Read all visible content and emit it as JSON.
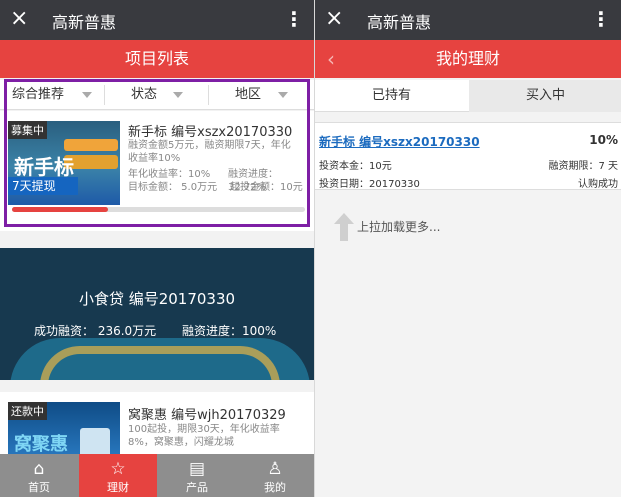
{
  "colors": {
    "accent": "#e64340",
    "titlebar": "#393a3f",
    "highlight": "#7e1fa5",
    "link": "#1c6bbf"
  },
  "left": {
    "titlebar": {
      "close_icon": "×",
      "title": "高新普惠",
      "more_icon": "⋮"
    },
    "header": "项目列表",
    "filters": [
      "综合推荐",
      "状态",
      "地区"
    ],
    "card1": {
      "status": "募集中",
      "thumb_big": "新手标",
      "thumb_strip": "7天提现",
      "title": "新手标 编号xszx20170330",
      "desc": "融资金额5万元，融资期限7天，年化",
      "desc2": "收益率10%",
      "rate_label": "年化收益率：10%",
      "progress_label": "融资进度：32.72%",
      "target_label": "目标金额：   5.0万元",
      "min_label": "起投金额：10元",
      "progress": 0.3272
    },
    "banner": {
      "title": "小食贷 编号20170330",
      "success": "成功融资：  236.0万元",
      "progress": "融资进度：100%"
    },
    "card2": {
      "status": "还款中",
      "thumb_big": "窝聚惠",
      "title": "窝聚惠 编号wjh20170329",
      "desc": "100起投，期限30天，年化收益率",
      "desc2": "8%，窝聚惠，闪耀龙城"
    },
    "tabs": [
      {
        "icon": "⌂",
        "label": "首页"
      },
      {
        "icon": "☆",
        "label": "理财"
      },
      {
        "icon": "▤",
        "label": "产品"
      },
      {
        "icon": "♙",
        "label": "我的"
      }
    ]
  },
  "right": {
    "titlebar": {
      "close_icon": "×",
      "title": "高新普惠",
      "more_icon": "⋮"
    },
    "header": "我的理财",
    "back_icon": "‹",
    "segments": [
      "已持有",
      "买入中"
    ],
    "item": {
      "name": "新手标 编号xszx20170330",
      "rate": "10%",
      "principal": "投资本金：10元",
      "term": "融资期限：7 天",
      "date": "投资日期：20170330",
      "status": "认购成功"
    },
    "load_more": "上拉加载更多..."
  }
}
